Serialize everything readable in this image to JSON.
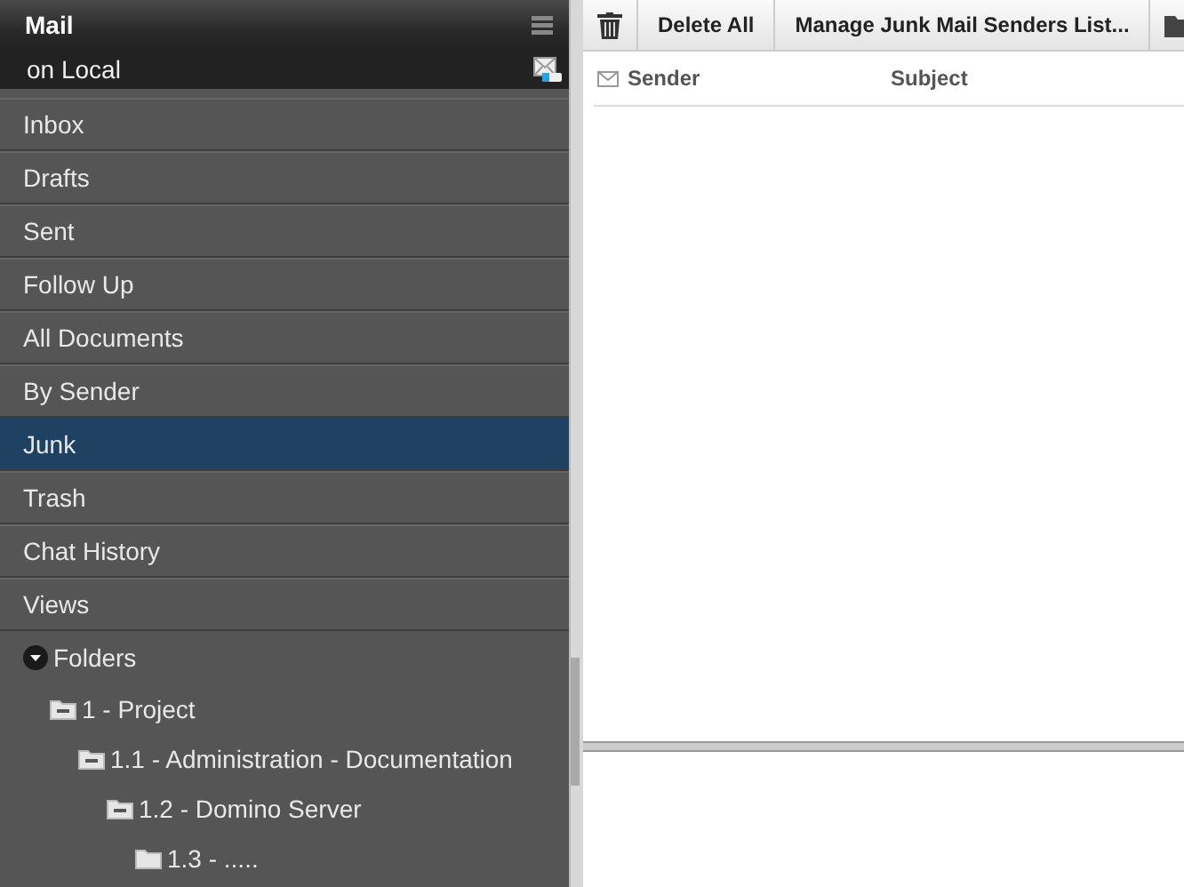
{
  "sidebar": {
    "title": "Mail",
    "location": "on Local",
    "items": [
      {
        "label": "Inbox",
        "selected": false
      },
      {
        "label": "Drafts",
        "selected": false
      },
      {
        "label": "Sent",
        "selected": false
      },
      {
        "label": "Follow Up",
        "selected": false
      },
      {
        "label": "All Documents",
        "selected": false
      },
      {
        "label": "By Sender",
        "selected": false
      },
      {
        "label": "Junk",
        "selected": true
      },
      {
        "label": "Trash",
        "selected": false
      },
      {
        "label": "Chat History",
        "selected": false
      },
      {
        "label": "Views",
        "selected": false
      }
    ],
    "folders": {
      "label": "Folders",
      "expanded": true,
      "children": [
        {
          "label": "1 - Project",
          "expanded": true,
          "children": [
            {
              "label": "1.1 - Administration - Documentation",
              "expanded": true,
              "children": [
                {
                  "label": "1.2 - Domino Server",
                  "expanded": true,
                  "children": [
                    {
                      "label": "1.3 - ....."
                    }
                  ]
                }
              ]
            }
          ]
        }
      ]
    }
  },
  "toolbar": {
    "buttons": [
      {
        "kind": "trash"
      },
      {
        "kind": "text",
        "label": "Delete All"
      },
      {
        "kind": "text",
        "label": "Manage Junk Mail Senders List..."
      },
      {
        "kind": "folder"
      }
    ]
  },
  "columns": [
    "Sender",
    "Subject"
  ]
}
